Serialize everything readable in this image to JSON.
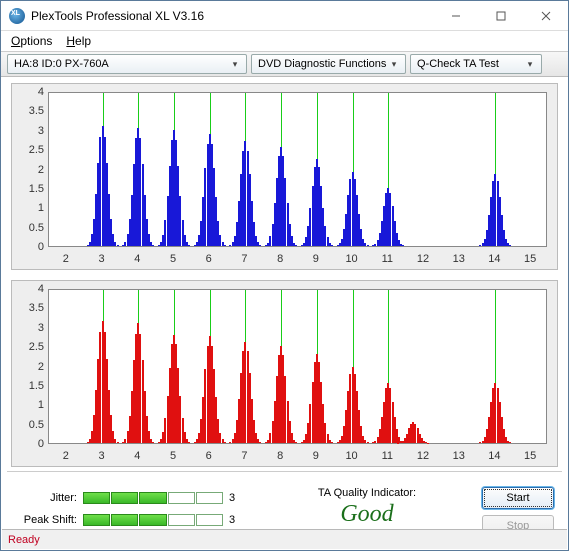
{
  "window": {
    "title": "PlexTools Professional XL V3.16",
    "minimize": "—",
    "maximize": "□",
    "close": "✕"
  },
  "menu": {
    "options": "Options",
    "help": "Help"
  },
  "toolbar": {
    "drive": "HA:8 ID:0   PX-760A",
    "category": "DVD Diagnostic Functions",
    "test": "Q-Check TA Test"
  },
  "chart_data": [
    {
      "type": "bar",
      "color": "#1818d8",
      "xlabel": "",
      "ylabel": "",
      "xlim": [
        1.5,
        15.5
      ],
      "ylim": [
        0,
        4
      ],
      "xticks": [
        2,
        3,
        4,
        5,
        6,
        7,
        8,
        9,
        10,
        11,
        12,
        13,
        14,
        15
      ],
      "yticks": [
        0,
        0.5,
        1,
        1.5,
        2,
        2.5,
        3,
        3.5,
        4
      ],
      "gridlines_x": [
        3,
        4,
        5,
        6,
        7,
        8,
        9,
        10,
        11,
        14
      ],
      "clusters": [
        {
          "center": 3,
          "peak": 3.1
        },
        {
          "center": 4,
          "peak": 3.05
        },
        {
          "center": 5,
          "peak": 3.0
        },
        {
          "center": 6,
          "peak": 2.9
        },
        {
          "center": 7,
          "peak": 2.7
        },
        {
          "center": 8,
          "peak": 2.55
        },
        {
          "center": 9,
          "peak": 2.25
        },
        {
          "center": 10,
          "peak": 1.9
        },
        {
          "center": 11,
          "peak": 1.5
        },
        {
          "center": 14,
          "peak": 1.85
        }
      ]
    },
    {
      "type": "bar",
      "color": "#e01010",
      "xlabel": "",
      "ylabel": "",
      "xlim": [
        1.5,
        15.5
      ],
      "ylim": [
        0,
        4
      ],
      "xticks": [
        2,
        3,
        4,
        5,
        6,
        7,
        8,
        9,
        10,
        11,
        12,
        13,
        14,
        15
      ],
      "yticks": [
        0,
        0.5,
        1,
        1.5,
        2,
        2.5,
        3,
        3.5,
        4
      ],
      "gridlines_x": [
        3,
        4,
        5,
        6,
        7,
        8,
        9,
        10,
        11,
        14
      ],
      "clusters": [
        {
          "center": 3,
          "peak": 3.15
        },
        {
          "center": 4,
          "peak": 3.1
        },
        {
          "center": 5,
          "peak": 2.8
        },
        {
          "center": 6,
          "peak": 2.75
        },
        {
          "center": 7,
          "peak": 2.6
        },
        {
          "center": 8,
          "peak": 2.5
        },
        {
          "center": 9,
          "peak": 2.3
        },
        {
          "center": 10,
          "peak": 1.95
        },
        {
          "center": 11,
          "peak": 1.55
        },
        {
          "center": 11.7,
          "peak": 0.55
        },
        {
          "center": 14,
          "peak": 1.55
        }
      ]
    }
  ],
  "meters": {
    "jitter": {
      "label": "Jitter:",
      "value": 3,
      "segments": 5
    },
    "peakshift": {
      "label": "Peak Shift:",
      "value": 3,
      "segments": 5
    }
  },
  "quality": {
    "label": "TA Quality Indicator:",
    "value": "Good"
  },
  "buttons": {
    "start": "Start",
    "stop": "Stop"
  },
  "status": "Ready"
}
